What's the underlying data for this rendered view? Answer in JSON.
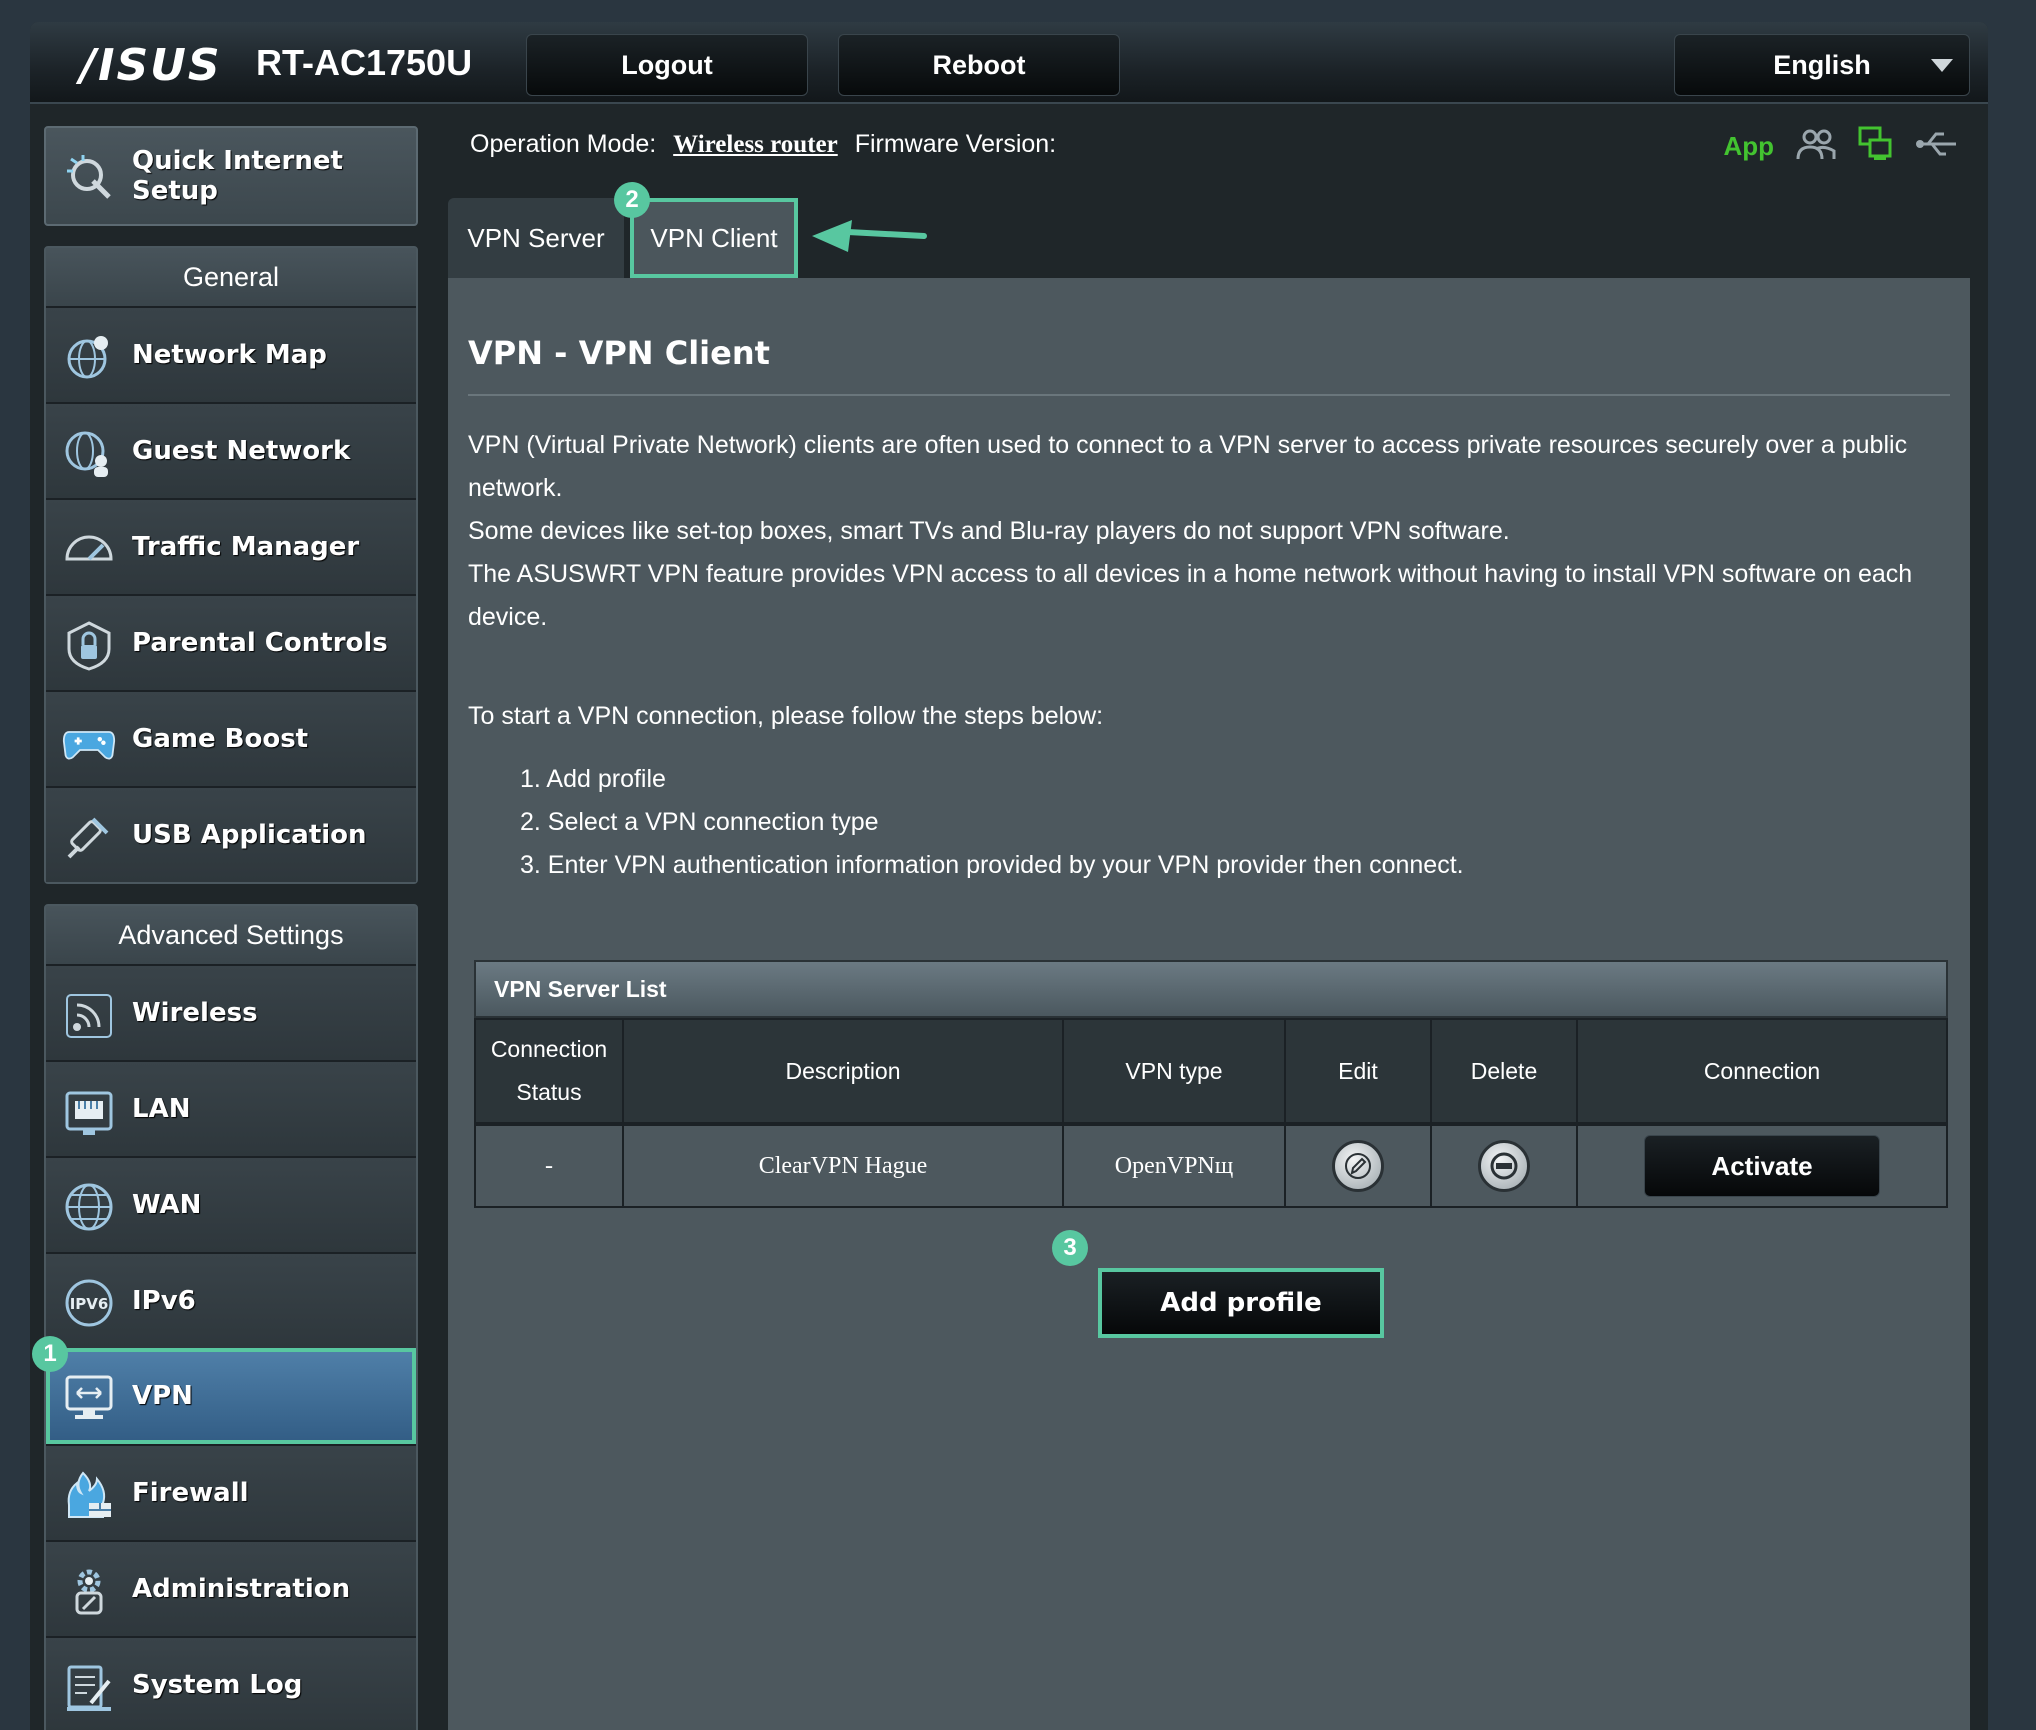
{
  "header": {
    "brand": "/ISUS",
    "model": "RT-AC1750U",
    "logout_label": "Logout",
    "reboot_label": "Reboot",
    "language_label": "English"
  },
  "status_bar": {
    "op_mode_label": "Operation Mode:",
    "op_mode_value": "Wireless router",
    "firmware_label": "Firmware Version:",
    "app_label": "App"
  },
  "sidebar": {
    "quick_setup": "Quick Internet Setup",
    "general_heading": "General",
    "general_items": [
      {
        "label": "Network Map",
        "icon": "globe-pin-icon"
      },
      {
        "label": "Guest Network",
        "icon": "globe-people-icon"
      },
      {
        "label": "Traffic Manager",
        "icon": "speedometer-icon"
      },
      {
        "label": "Parental Controls",
        "icon": "lock-shield-icon"
      },
      {
        "label": "Game Boost",
        "icon": "gamepad-icon"
      },
      {
        "label": "USB Application",
        "icon": "usb-tools-icon"
      }
    ],
    "advanced_heading": "Advanced Settings",
    "advanced_items": [
      {
        "label": "Wireless",
        "icon": "wifi-icon"
      },
      {
        "label": "LAN",
        "icon": "lan-port-icon"
      },
      {
        "label": "WAN",
        "icon": "globe-icon"
      },
      {
        "label": "IPv6",
        "icon": "ipv6-globe-icon"
      },
      {
        "label": "VPN",
        "icon": "vpn-monitor-icon"
      },
      {
        "label": "Firewall",
        "icon": "firewall-icon"
      },
      {
        "label": "Administration",
        "icon": "admin-gear-icon"
      },
      {
        "label": "System Log",
        "icon": "system-log-icon"
      }
    ]
  },
  "tabs": {
    "server": "VPN Server",
    "client": "VPN Client"
  },
  "badges": {
    "one": "1",
    "two": "2",
    "three": "3"
  },
  "main": {
    "title": "VPN - VPN Client",
    "desc_1": "VPN (Virtual Private Network) clients are often used to connect to a VPN server to access private resources securely over a public network.",
    "desc_2": "Some devices like set-top boxes, smart TVs and Blu-ray players do not support VPN software.",
    "desc_3": "The ASUSWRT VPN feature provides VPN access to all devices in a home network without having to install VPN software on each device.",
    "steps_intro": "To start a VPN connection, please follow the steps below:",
    "steps": [
      "1. Add profile",
      "2. Select a VPN connection type",
      "3. Enter VPN authentication information provided by your VPN provider then connect."
    ]
  },
  "server_list": {
    "title": "VPN Server List",
    "headers": {
      "status_1": "Connection",
      "status_2": "Status",
      "description": "Description",
      "vpn_type": "VPN type",
      "edit": "Edit",
      "delete": "Delete",
      "connection": "Connection"
    },
    "rows": [
      {
        "status": "-",
        "description": "ClearVPN Hague",
        "vpn_type": "OpenVPNщ",
        "action": "Activate"
      }
    ]
  },
  "add_profile_label": "Add profile",
  "colors": {
    "accent_highlight": "#58c7a0",
    "app_green": "#43c330",
    "vpn_active": "#3f6e97"
  }
}
